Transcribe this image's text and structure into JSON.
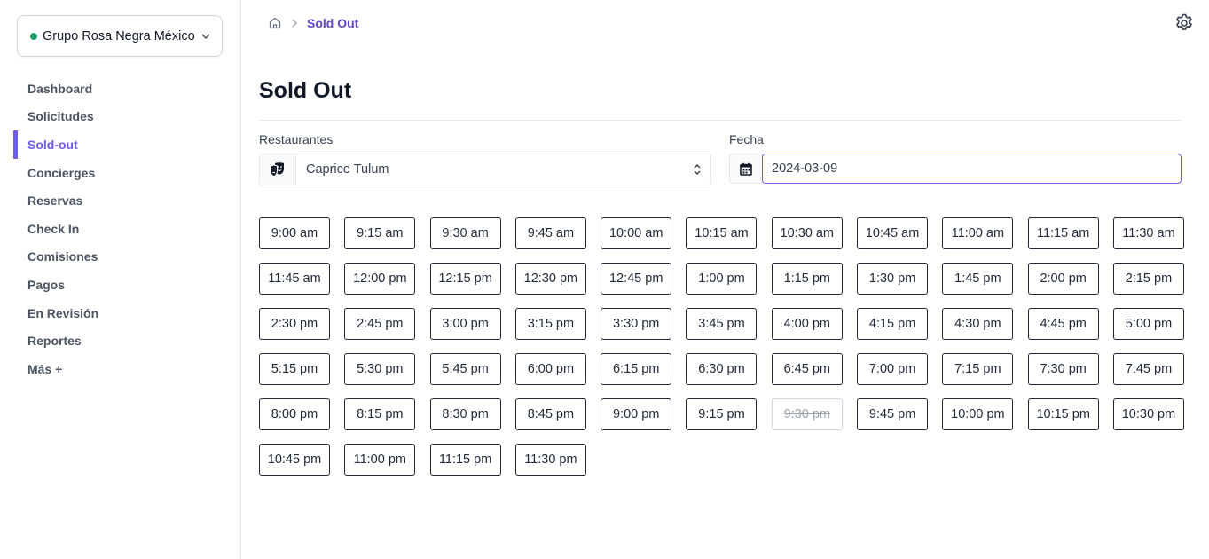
{
  "org": {
    "name": "Grupo Rosa Negra México",
    "status_color": "#22a06b"
  },
  "nav": {
    "items": [
      {
        "label": "Dashboard",
        "active": false
      },
      {
        "label": "Solicitudes",
        "active": false
      },
      {
        "label": "Sold-out",
        "active": true
      },
      {
        "label": "Concierges",
        "active": false
      },
      {
        "label": "Reservas",
        "active": false
      },
      {
        "label": "Check In",
        "active": false
      },
      {
        "label": "Comisiones",
        "active": false
      },
      {
        "label": "Pagos",
        "active": false
      },
      {
        "label": "En Revisión",
        "active": false
      },
      {
        "label": "Reportes",
        "active": false
      },
      {
        "label": "Más +",
        "active": false
      }
    ]
  },
  "breadcrumb": {
    "current": "Sold Out"
  },
  "page": {
    "title": "Sold Out"
  },
  "filters": {
    "restaurant_label": "Restaurantes",
    "restaurant_value": "Caprice Tulum",
    "date_label": "Fecha",
    "date_value": "2024-03-09"
  },
  "slots": [
    {
      "time": "9:00 am",
      "sold_out": false
    },
    {
      "time": "9:15 am",
      "sold_out": false
    },
    {
      "time": "9:30 am",
      "sold_out": false
    },
    {
      "time": "9:45 am",
      "sold_out": false
    },
    {
      "time": "10:00 am",
      "sold_out": false
    },
    {
      "time": "10:15 am",
      "sold_out": false
    },
    {
      "time": "10:30 am",
      "sold_out": false
    },
    {
      "time": "10:45 am",
      "sold_out": false
    },
    {
      "time": "11:00 am",
      "sold_out": false
    },
    {
      "time": "11:15 am",
      "sold_out": false
    },
    {
      "time": "11:30 am",
      "sold_out": false
    },
    {
      "time": "11:45 am",
      "sold_out": false
    },
    {
      "time": "12:00 pm",
      "sold_out": false
    },
    {
      "time": "12:15 pm",
      "sold_out": false
    },
    {
      "time": "12:30 pm",
      "sold_out": false
    },
    {
      "time": "12:45 pm",
      "sold_out": false
    },
    {
      "time": "1:00 pm",
      "sold_out": false
    },
    {
      "time": "1:15 pm",
      "sold_out": false
    },
    {
      "time": "1:30 pm",
      "sold_out": false
    },
    {
      "time": "1:45 pm",
      "sold_out": false
    },
    {
      "time": "2:00 pm",
      "sold_out": false
    },
    {
      "time": "2:15 pm",
      "sold_out": false
    },
    {
      "time": "2:30 pm",
      "sold_out": false
    },
    {
      "time": "2:45 pm",
      "sold_out": false
    },
    {
      "time": "3:00 pm",
      "sold_out": false
    },
    {
      "time": "3:15 pm",
      "sold_out": false
    },
    {
      "time": "3:30 pm",
      "sold_out": false
    },
    {
      "time": "3:45 pm",
      "sold_out": false
    },
    {
      "time": "4:00 pm",
      "sold_out": false
    },
    {
      "time": "4:15 pm",
      "sold_out": false
    },
    {
      "time": "4:30 pm",
      "sold_out": false
    },
    {
      "time": "4:45 pm",
      "sold_out": false
    },
    {
      "time": "5:00 pm",
      "sold_out": false
    },
    {
      "time": "5:15 pm",
      "sold_out": false
    },
    {
      "time": "5:30 pm",
      "sold_out": false
    },
    {
      "time": "5:45 pm",
      "sold_out": false
    },
    {
      "time": "6:00 pm",
      "sold_out": false
    },
    {
      "time": "6:15 pm",
      "sold_out": false
    },
    {
      "time": "6:30 pm",
      "sold_out": false
    },
    {
      "time": "6:45 pm",
      "sold_out": false
    },
    {
      "time": "7:00 pm",
      "sold_out": false
    },
    {
      "time": "7:15 pm",
      "sold_out": false
    },
    {
      "time": "7:30 pm",
      "sold_out": false
    },
    {
      "time": "7:45 pm",
      "sold_out": false
    },
    {
      "time": "8:00 pm",
      "sold_out": false
    },
    {
      "time": "8:15 pm",
      "sold_out": false
    },
    {
      "time": "8:30 pm",
      "sold_out": false
    },
    {
      "time": "8:45 pm",
      "sold_out": false
    },
    {
      "time": "9:00 pm",
      "sold_out": false
    },
    {
      "time": "9:15 pm",
      "sold_out": false
    },
    {
      "time": "9:30 pm",
      "sold_out": true
    },
    {
      "time": "9:45 pm",
      "sold_out": false
    },
    {
      "time": "10:00 pm",
      "sold_out": false
    },
    {
      "time": "10:15 pm",
      "sold_out": false
    },
    {
      "time": "10:30 pm",
      "sold_out": false
    },
    {
      "time": "10:45 pm",
      "sold_out": false
    },
    {
      "time": "11:00 pm",
      "sold_out": false
    },
    {
      "time": "11:15 pm",
      "sold_out": false
    },
    {
      "time": "11:30 pm",
      "sold_out": false
    }
  ],
  "colors": {
    "accent": "#6d5ce6",
    "breadcrumb": "#5b47c8"
  },
  "icons": {
    "home": "home-icon",
    "settings": "gear-icon",
    "restaurant": "theater-masks-icon",
    "calendar": "calendar-icon"
  }
}
